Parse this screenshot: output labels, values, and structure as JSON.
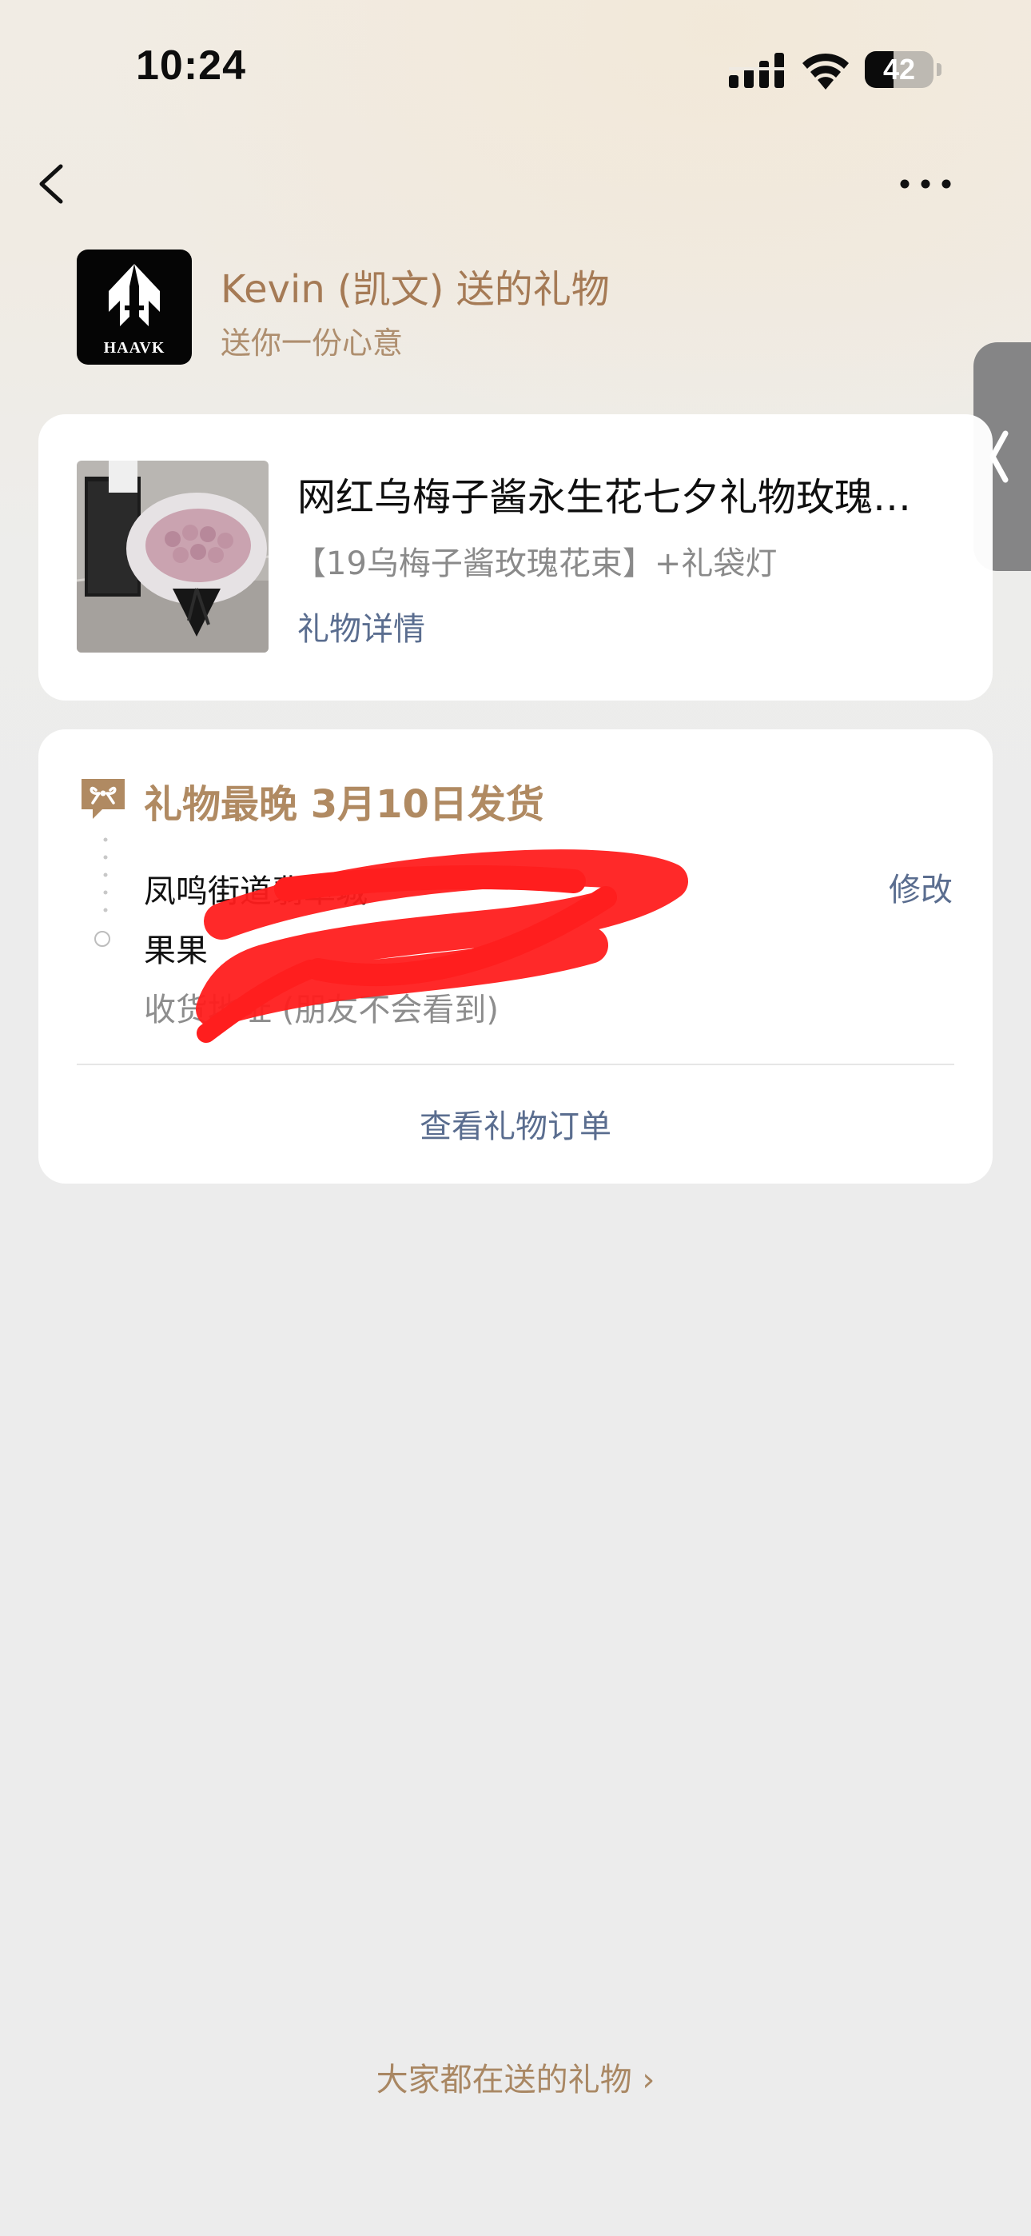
{
  "status_bar": {
    "time": "10:24",
    "battery_level": "42",
    "battery_fraction": 0.42,
    "icons": [
      "signal-icon",
      "wifi-icon",
      "battery-icon"
    ]
  },
  "nav": {
    "back_icon": "chevron-left-icon",
    "more_icon": "more-dots-icon"
  },
  "sender": {
    "logo_text": "HAAVK",
    "title": "Kevin (凯文) 送的礼物",
    "subtitle": "送你一份心意"
  },
  "side_tab": {
    "icon": "chevron-left-icon"
  },
  "gift": {
    "title": "网红乌梅子酱永生花七夕礼物玫瑰…",
    "spec": "【19乌梅子酱玫瑰花束】+礼袋灯",
    "detail_link": "礼物详情",
    "thumb_icon": "bouquet-image"
  },
  "shipping": {
    "icon": "gift-icon",
    "title": "礼物最晚 3月10日发货",
    "address": "凤鸣街道翡翠城",
    "recipient": "果果",
    "note": "收货地址 (朋友不会看到)",
    "modify_label": "修改",
    "view_order_label": "查看礼物订单"
  },
  "footer": {
    "link_label": "大家都在送的礼物 ›"
  },
  "colors": {
    "accent_gold": "#a57a55",
    "link_blue": "#5a6d8f",
    "redaction_red": "#ff2020",
    "page_bg": "#ececec"
  }
}
